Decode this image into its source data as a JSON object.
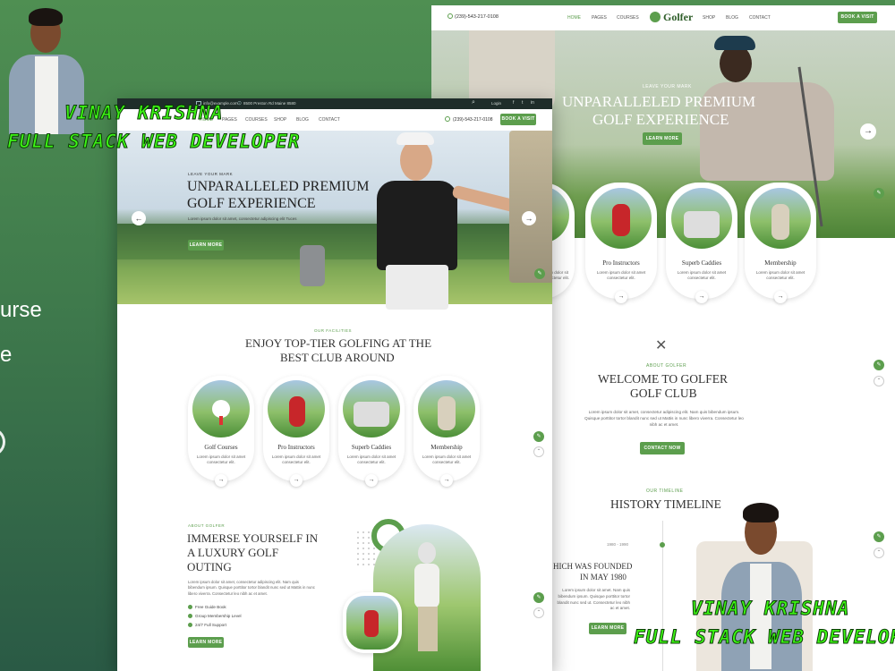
{
  "left_fragments": [
    "urse",
    "e"
  ],
  "overlay": {
    "name": "VINAY KRISHNA",
    "role": "FULL STACK WEB DEVELOPER"
  },
  "back": {
    "phone": "(239)-543-217-0108",
    "logo": "Golfer",
    "nav": [
      "HOME",
      "PAGES",
      "COURSES",
      "SHOP",
      "BLOG",
      "CONTACT"
    ],
    "book_btn": "BOOK A VISIT",
    "hero": {
      "eyebrow": "LEAVE YOUR MARK",
      "title_line1": "UNPARALLELED PREMIUM",
      "title_line2": "GOLF EXPERIENCE",
      "button": "LEARN MORE"
    },
    "cards": [
      {
        "title": "rses",
        "desc": "Lorem ipsum dolor sit amet, consectetur elit."
      },
      {
        "title": "Pro Instructors",
        "desc": "Lorem ipsum dolor sit amet consectetur elit."
      },
      {
        "title": "Superb Caddies",
        "desc": "Lorem ipsum dolor sit amet consectetur elit."
      },
      {
        "title": "Membership",
        "desc": "Lorem ipsum dolor sit amet consectetur elit."
      }
    ],
    "welcome": {
      "eyebrow": "ABOUT GOLFER",
      "title_line1": "WELCOME TO GOLFER",
      "title_line2": "GOLF CLUB",
      "text": "Lorem ipsum dolor sit amet, consectetur adipiscing elit. Nam quis bibendum ipsum. Quisque porttitor tortor blandit nunc sed ut Mattis in nunc libero viverra. Consectetur leo nibh ac et amet.",
      "button": "CONTACT NOW"
    },
    "timeline": {
      "eyebrow": "OUR TIMELINE",
      "title": "HISTORY TIMELINE",
      "years": "1980 - 1990",
      "event_line1": "HICH WAS FOUNDED",
      "event_line2": "IN MAY 1980",
      "text": "Lorem ipsum dolor sit amet. Nam quis bibendum ipsum. Quisque porttitor tortor blandit nunc sed ut. Consectetur leo nibh ac et amet.",
      "button": "LEARN MORE"
    }
  },
  "front": {
    "topbar": {
      "email": "info@example.com",
      "address": "8500 Preston Rd Maine 8580",
      "login": "Login"
    },
    "nav": [
      "HOME",
      "PAGES",
      "COURSES",
      "SHOP",
      "BLOG",
      "CONTACT"
    ],
    "phone": "(239)-543-217-0108",
    "book_btn": "BOOK A VISIT",
    "hero": {
      "eyebrow": "LEAVE YOUR MARK",
      "title_line1": "UNPARALLELED PREMIUM",
      "title_line2": "GOLF EXPERIENCE",
      "text": "Lorem ipsum dolor sit amet, consectetur adipiscing elit Tuces",
      "button": "LEARN MORE"
    },
    "facilities": {
      "eyebrow": "OUR FACILITIES",
      "title_line1": "ENJOY TOP-TIER GOLFING AT THE",
      "title_line2": "BEST CLUB AROUND",
      "cards": [
        {
          "title": "Golf Courses",
          "desc": "Lorem ipsum dolor sit amet consectetur elit."
        },
        {
          "title": "Pro Instructors",
          "desc": "Lorem ipsum dolor sit amet consectetur elit."
        },
        {
          "title": "Superb Caddies",
          "desc": "Lorem ipsum dolor sit amet consectetur elit."
        },
        {
          "title": "Membership",
          "desc": "Lorem ipsum dolor sit amet consectetur elit."
        }
      ]
    },
    "about": {
      "eyebrow": "ABOUT GOLFER",
      "title_line1": "IMMERSE YOURSELF IN",
      "title_line2": "A LUXURY GOLF",
      "title_line3": "OUTING",
      "text": "Lorem ipsum dolor sit amet, consectetur adipiscing elit. Nam quis bibendum ipsum. Quisque porttitor tortor blandit nunc sed ut Mattis in nunc libero viverra. Consectetur leo nibh ac et amet.",
      "features": [
        "Free Guide Book",
        "Group Membership Level",
        "24/7 Full Support"
      ],
      "button": "LEARN MORE"
    }
  },
  "colors": {
    "accent": "#5c9e4d",
    "overlay_text": "#3df515"
  }
}
